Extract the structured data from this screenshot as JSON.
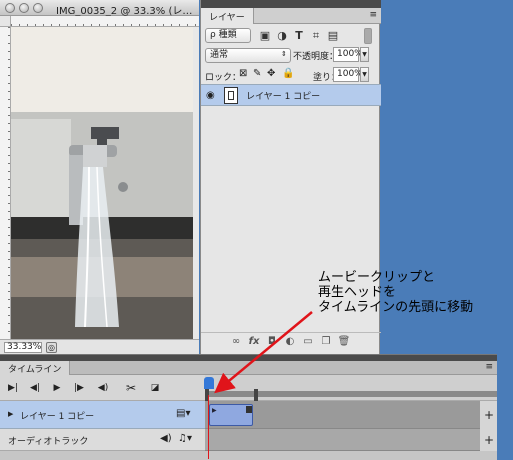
{
  "document": {
    "title": "IMG_0035_2 @ 33.3% (レ…",
    "zoom": "33.33%"
  },
  "layers_panel": {
    "tab_label": "レイヤー",
    "filter_label": "ρ 種類",
    "blend_mode": "通常",
    "opacity_label": "不透明度：",
    "opacity_value": "100%",
    "lock_label": "ロック：",
    "fill_label": "塗り：",
    "fill_value": "100%",
    "filter_icons": [
      "image-filter-icon",
      "adjustment-filter-icon",
      "type-filter-icon",
      "shape-filter-icon",
      "smart-object-filter-icon"
    ],
    "layers": [
      {
        "name": "レイヤー 1 コピー",
        "visible": true,
        "type": "video"
      }
    ]
  },
  "timeline": {
    "tab_label": "タイムライン",
    "tracks": [
      {
        "name": "レイヤー 1 コピー"
      },
      {
        "name": "オーディオトラック"
      }
    ],
    "add_symbol": "+"
  },
  "annotation": {
    "lines": [
      "ムービークリップと",
      "再生ヘッドを",
      "タイムラインの先頭に移動"
    ],
    "color": "#e0141a"
  }
}
